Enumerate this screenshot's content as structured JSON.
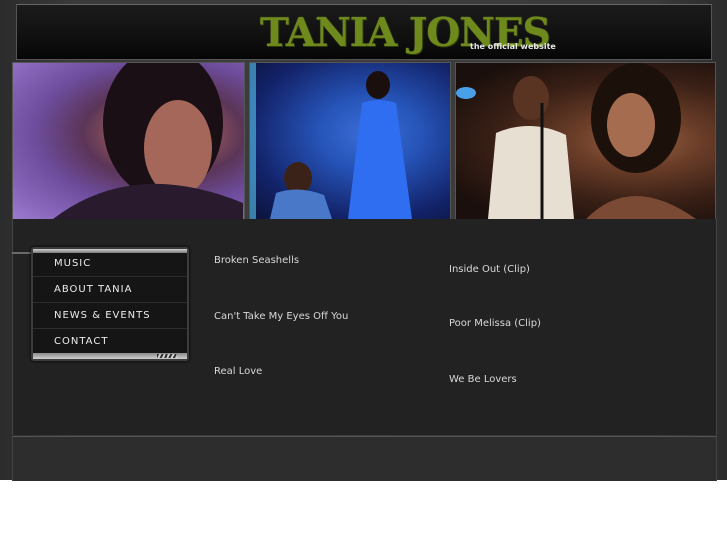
{
  "header": {
    "title": "TANIA JONES",
    "subtitle": "the official website"
  },
  "photos": [
    {
      "name": "tania-portrait-photo"
    },
    {
      "name": "tania-stage-photo"
    },
    {
      "name": "tania-band-photo"
    }
  ],
  "menu": {
    "items": [
      {
        "label": "MUSIC"
      },
      {
        "label": "ABOUT TANIA"
      },
      {
        "label": "NEWS & EVENTS"
      },
      {
        "label": "CONTACT"
      }
    ]
  },
  "songs": {
    "left": [
      {
        "title": "Broken Seashells"
      },
      {
        "title": "Can't Take My Eyes Off You"
      },
      {
        "title": "Real Love"
      }
    ],
    "right": [
      {
        "title": "Inside Out (Clip)"
      },
      {
        "title": "Poor Melissa (Clip)"
      },
      {
        "title": "We Be Lovers"
      }
    ]
  },
  "colors": {
    "logo": "#6f8a1c",
    "background": "#222222",
    "text": "#d8d8d8"
  }
}
